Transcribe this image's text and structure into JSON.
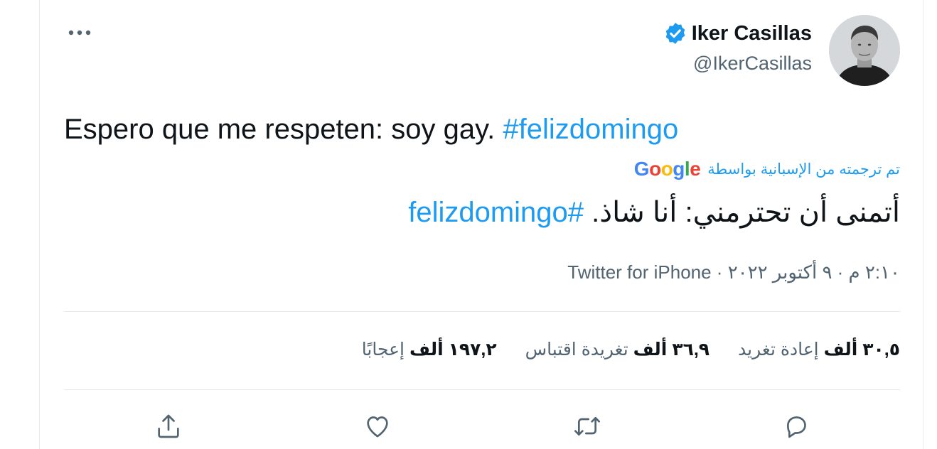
{
  "author": {
    "name": "Iker Casillas",
    "handle": "@IkerCasillas",
    "verified": true
  },
  "tweet": {
    "text": "Espero que me respeten: soy gay. ",
    "hashtag": "#felizdomingo"
  },
  "translation": {
    "label": "تم ترجمته من الإسبانية بواسطة",
    "provider": [
      "G",
      "o",
      "o",
      "g",
      "l",
      "e"
    ],
    "text": "أتمنى أن تحترمني: أنا شاذ. ",
    "hashtag": "#felizdomingo"
  },
  "meta": {
    "time": "٢:١٠ م",
    "separator": " · ",
    "date": "٩ أكتوبر ٢٠٢٢",
    "source": "Twitter for iPhone"
  },
  "stats": {
    "retweets": {
      "count": "٣٠,٥ ألف",
      "label": "إعادة تغريد"
    },
    "quotes": {
      "count": "٣٦,٩ ألف",
      "label": "تغريدة اقتباس"
    },
    "likes": {
      "count": "١٩٧,٢ ألف",
      "label": "إعجابًا"
    }
  },
  "icons": {
    "more": "more-horizontal-icon",
    "reply": "reply-icon",
    "retweet": "retweet-icon",
    "like": "heart-icon",
    "share": "share-icon",
    "verified": "verified-badge-icon"
  },
  "colors": {
    "accent": "#1d9bf0",
    "text": "#0f1419",
    "secondary": "#536471",
    "border": "#e7e9ea"
  }
}
